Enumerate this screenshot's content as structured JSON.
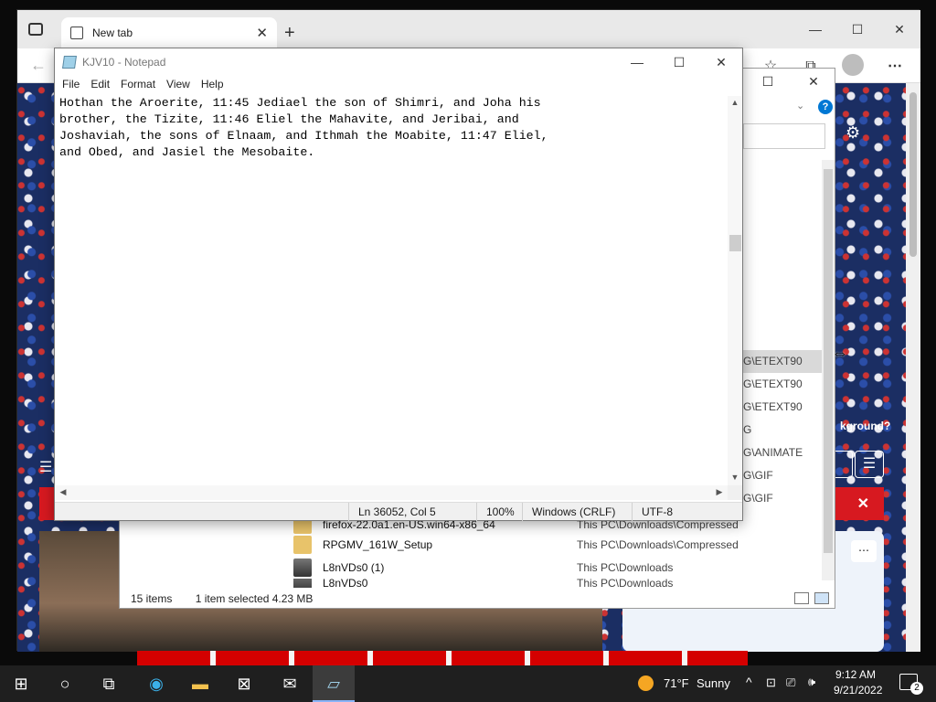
{
  "browser": {
    "tab_title": "New tab",
    "tab_close": "✕",
    "new_tab": "+",
    "minimize": "—",
    "maximize": "☐",
    "close": "✕",
    "more": "⋯",
    "background_question": "kground?",
    "banner_close": "✕"
  },
  "explorer": {
    "files": [
      {
        "name": "firefox-22.0a1.en-US.win64-x86_64",
        "location": "This PC\\Downloads\\Compressed",
        "icon": "folder-zip-icon"
      },
      {
        "name": "RPGMV_161W_Setup",
        "location": "This PC\\Downloads\\Compressed",
        "icon": "folder-zip-icon"
      },
      {
        "name": "L8nVDs0 (1)",
        "location": "This PC\\Downloads",
        "icon": "image-icon"
      },
      {
        "name": "L8nVDs0",
        "location": "This PC\\Downloads",
        "icon": "image-icon"
      }
    ],
    "path_fragments": [
      "G\\ETEXT90",
      "G\\ETEXT90",
      "G\\ETEXT90",
      "G",
      "G\\ANIMATE",
      "G\\GIF",
      "G\\GIF"
    ],
    "status_count": "15 items",
    "status_selected": "1 item selected  4.23 MB",
    "close": "✕",
    "maximize": "☐"
  },
  "notepad": {
    "title": "KJV10 - Notepad",
    "minimize": "—",
    "maximize": "☐",
    "close": "✕",
    "menu": [
      "File",
      "Edit",
      "Format",
      "View",
      "Help"
    ],
    "text": "Hothan the Aroerite, 11:45 Jediael the son of Shimri, and Joha his\nbrother, the Tizite, 11:46 Eliel the Mahavite, and Jeribai, and\nJoshaviah, the sons of Elnaam, and Ithmah the Moabite, 11:47 Eliel,\nand Obed, and Jasiel the Mesobaite.",
    "status": {
      "position": "Ln 36052, Col 5",
      "zoom": "100%",
      "line_ending": "Windows (CRLF)",
      "encoding": "UTF-8"
    }
  },
  "taskbar": {
    "temperature": "71°F",
    "weather": "Sunny",
    "time": "9:12 AM",
    "date": "9/21/2022",
    "notifications": "2"
  },
  "colors": {
    "taskbar_bg": "#1f1f1f",
    "banner_red": "#d71920",
    "accent": "#0078d4"
  }
}
